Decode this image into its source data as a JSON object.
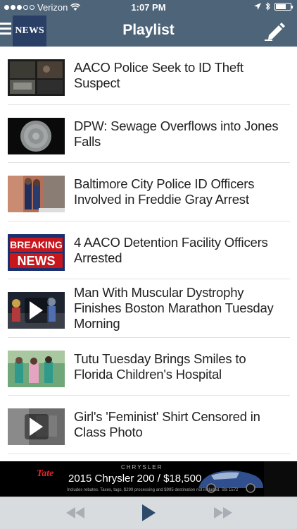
{
  "status_bar": {
    "carrier": "Verizon",
    "time": "1:07 PM",
    "signal_bars_filled": 3,
    "signal_bars_total": 5,
    "battery_level": 0.7
  },
  "nav": {
    "logo_text": "NEWS",
    "title": "Playlist"
  },
  "playlist": [
    {
      "title": "AACO Police Seek to ID Theft Suspect",
      "thumb": "security-footage",
      "has_play": false
    },
    {
      "title": "DPW: Sewage Overflows into Jones Falls",
      "thumb": "manhole-cover",
      "has_play": false
    },
    {
      "title": "Baltimore City Police ID Officers Involved in Freddie Gray Arrest",
      "thumb": "police-officers",
      "has_play": false
    },
    {
      "title": "4 AACO Detention Facility Officers Arrested",
      "thumb": "breaking-news",
      "has_play": false
    },
    {
      "title": "Man With Muscular Dystrophy Finishes Boston Marathon Tuesday Morning",
      "thumb": "marathon",
      "has_play": true
    },
    {
      "title": "Tutu Tuesday Brings Smiles to Florida Children's Hospital",
      "thumb": "hospital",
      "has_play": false
    },
    {
      "title": "Girl's 'Feminist' Shirt Censored in Class Photo",
      "thumb": "classroom",
      "has_play": true
    }
  ],
  "breaking_news_thumb": {
    "line1": "BREAKING",
    "line2": "NEWS"
  },
  "ad": {
    "logo": "Tate",
    "brand": "CHRYSLER",
    "main_text": "2015 Chrysler 200  /  $18,500",
    "fine_print": "Includes rebates. Taxes, tags, $299 processing and $995 destination not included. Stk 1572"
  },
  "player": {
    "prev_icon": "rewind-icon",
    "play_icon": "play-icon",
    "next_icon": "fast-forward-icon"
  },
  "colors": {
    "header": "#4e6479",
    "accent_red": "#e8242a",
    "player_bar": "#d8dcde",
    "play_button": "#2d4a6b"
  }
}
